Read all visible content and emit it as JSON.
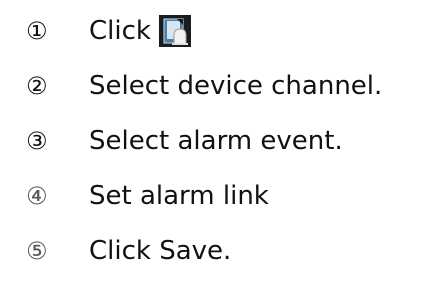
{
  "steps": [
    {
      "marker": "①",
      "text": "Click",
      "icon": "alarm-config-icon"
    },
    {
      "marker": "②",
      "text": "Select device channel."
    },
    {
      "marker": "③",
      "text": "Select alarm event."
    },
    {
      "marker": "④",
      "text": "Set alarm link"
    },
    {
      "marker": "⑤",
      "text": "Click Save."
    }
  ]
}
